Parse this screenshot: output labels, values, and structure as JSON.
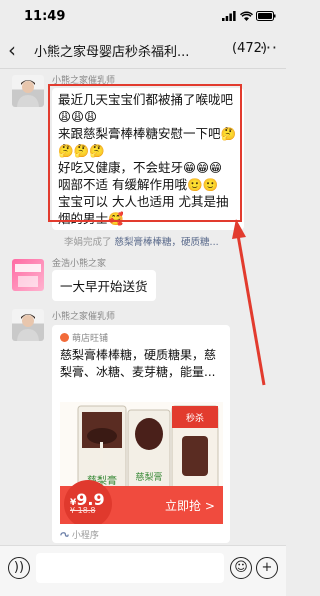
{
  "status": {
    "time": "11:49"
  },
  "header": {
    "title": "小熊之家母婴店秒杀福利...",
    "count": "(472)"
  },
  "messages": [
    {
      "sender": "小熊之家催乳师",
      "lines": [
        "最近几天宝宝们都被捅了喉咙吧",
        "😩😩😩",
        "来跟慈梨膏棒棒糖安慰一下吧🤔",
        "🤔🤔🤔",
        "好吃又健康，不会蛀牙😁😁😁",
        "咽部不适 有缓解作用哦🙂🙂",
        "宝宝可以 大人也适用 尤其是抽",
        "烟的男士🥰"
      ]
    },
    {
      "sender": "金浩小熊之家",
      "text": "一大早开始送货"
    },
    {
      "sender": "小熊之家催乳师",
      "card": {
        "shop": "萌店旺铺",
        "title": "慈梨膏棒棒糖，硬质糖果，慈梨膏、冰糖、麦芽糖，能量...",
        "price": "9.9",
        "price_label": "¥",
        "old_price": "¥ 18.8",
        "buy": "立即抢 >",
        "badge": "秒杀",
        "brand": "慈梨膏",
        "footer": "小程序"
      }
    }
  ],
  "system_notice": {
    "prefix": "李娟完成了",
    "link": "慈梨膏棒棒糖，硬质糖...",
    "link_color": "#5b6b8c"
  },
  "colors": {
    "accent_red": "#e23b2e",
    "brand_orange": "#f26b3a"
  },
  "icons": [
    "back-icon",
    "more-icon",
    "voice-icon",
    "emoji-icon",
    "plus-icon"
  ]
}
